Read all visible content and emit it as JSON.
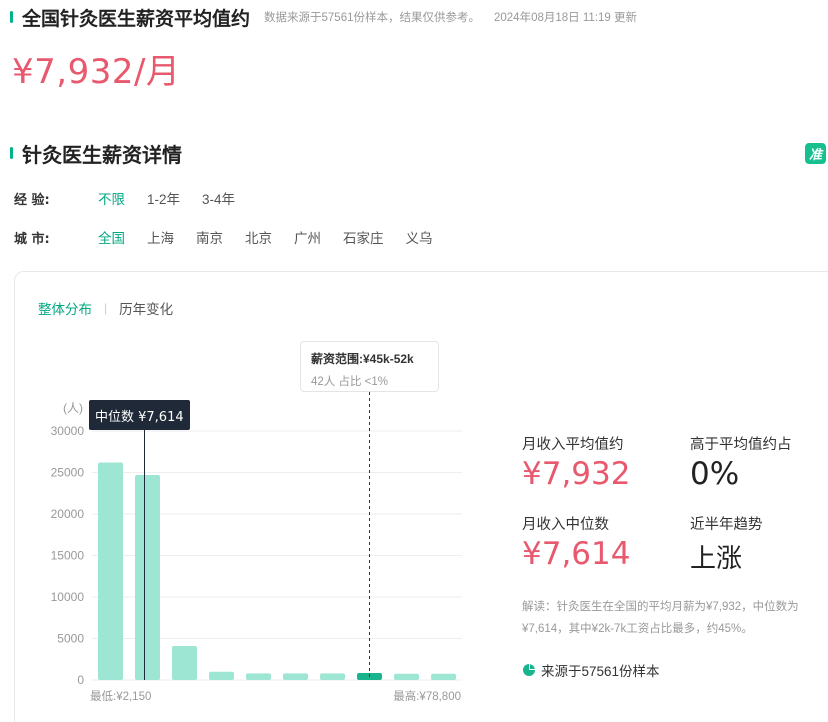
{
  "header": {
    "title": "全国针灸医生薪资平均值约",
    "note": "数据来源于57561份样本，结果仅供参考。",
    "updated": "2024年08月18日 11:19 更新",
    "average_salary": "¥7,932/月"
  },
  "section": {
    "title": "针灸医生薪资详情",
    "badge": "准"
  },
  "filters": {
    "experience": {
      "label": "经 验:",
      "options": [
        {
          "label": "不限",
          "active": true
        },
        {
          "label": "1-2年",
          "active": false
        },
        {
          "label": "3-4年",
          "active": false
        }
      ]
    },
    "city": {
      "label": "城 市:",
      "options": [
        {
          "label": "全国",
          "active": true
        },
        {
          "label": "上海",
          "active": false
        },
        {
          "label": "南京",
          "active": false
        },
        {
          "label": "北京",
          "active": false
        },
        {
          "label": "广州",
          "active": false
        },
        {
          "label": "石家庄",
          "active": false
        },
        {
          "label": "义乌",
          "active": false
        }
      ]
    }
  },
  "tabs": [
    {
      "label": "整体分布",
      "active": true
    },
    {
      "label": "历年变化",
      "active": false
    }
  ],
  "tooltip": {
    "title": "薪资范围:¥45k-52k",
    "detail": "42人  占比 <1%"
  },
  "median_tag": "中位数 ¥7,614",
  "chart_data": {
    "type": "bar",
    "ylabel": "(人)",
    "ylim": [
      0,
      30000
    ],
    "yticks": [
      "30000",
      "25000",
      "20000",
      "15000",
      "10000",
      "5000",
      "0"
    ],
    "values": [
      26200,
      24700,
      4100,
      1000,
      800,
      800,
      800,
      850,
      750,
      750
    ],
    "highlight_index": 7,
    "median_index": 1,
    "min_label": "最低:¥2,150",
    "max_label": "最高:¥78,800",
    "colors": {
      "bar": "#9ee6d4",
      "highlight": "#18b48e",
      "grid": "#eeeeee",
      "axis_text": "#999999"
    }
  },
  "stats": {
    "avg_label": "月收入平均值约",
    "avg_value": "¥7,932",
    "above_avg_label": "高于平均值约占",
    "above_avg_value": "0%",
    "median_label": "月收入中位数",
    "median_value": "¥7,614",
    "trend_label": "近半年趋势",
    "trend_value": "上涨"
  },
  "explanation": "解读：针灸医生在全国的平均月薪为¥7,932，中位数为¥7,614，其中¥2k-7k工资占比最多，约45%。",
  "source": "来源于57561份样本"
}
